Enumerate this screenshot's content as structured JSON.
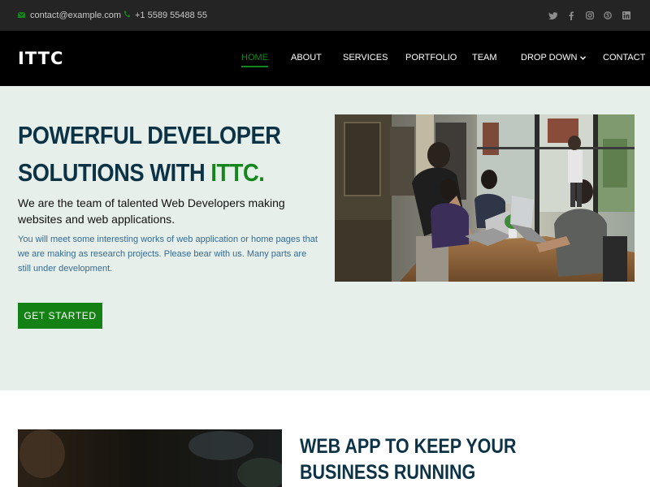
{
  "topbar": {
    "email": "contact@example.com",
    "phone": "+1 5589 55488 55",
    "socials": [
      "twitter-icon",
      "facebook-icon",
      "instagram-icon",
      "skype-icon",
      "linkedin-icon"
    ]
  },
  "header": {
    "logo": "ITTC",
    "nav": {
      "home": "HOME",
      "about": "ABOUT",
      "services": "SERVICES",
      "portfolio": "PORTFOLIO",
      "team": "TEAM",
      "dropdown": "DROP DOWN",
      "contact": "CONTACT"
    }
  },
  "hero": {
    "title_main": "POWERFUL DEVELOPER SOLUTIONS WITH ",
    "title_brand": "ITTC.",
    "lead": "We are the team of talented Web Developers making websites and web applications.",
    "sub": "You will meet some interesting works of web application or home pages that we are making as research projects. Please bear with us. Many parts are still under development.",
    "cta": "GET STARTED"
  },
  "section2": {
    "title": "WEB APP TO KEEP YOUR BUSINESS RUNNING"
  },
  "colors": {
    "accent": "#15861b",
    "heading": "#0c3246",
    "topbar_bg": "#242424",
    "header_bg": "#000000",
    "hero_bg": "#e7efea"
  }
}
